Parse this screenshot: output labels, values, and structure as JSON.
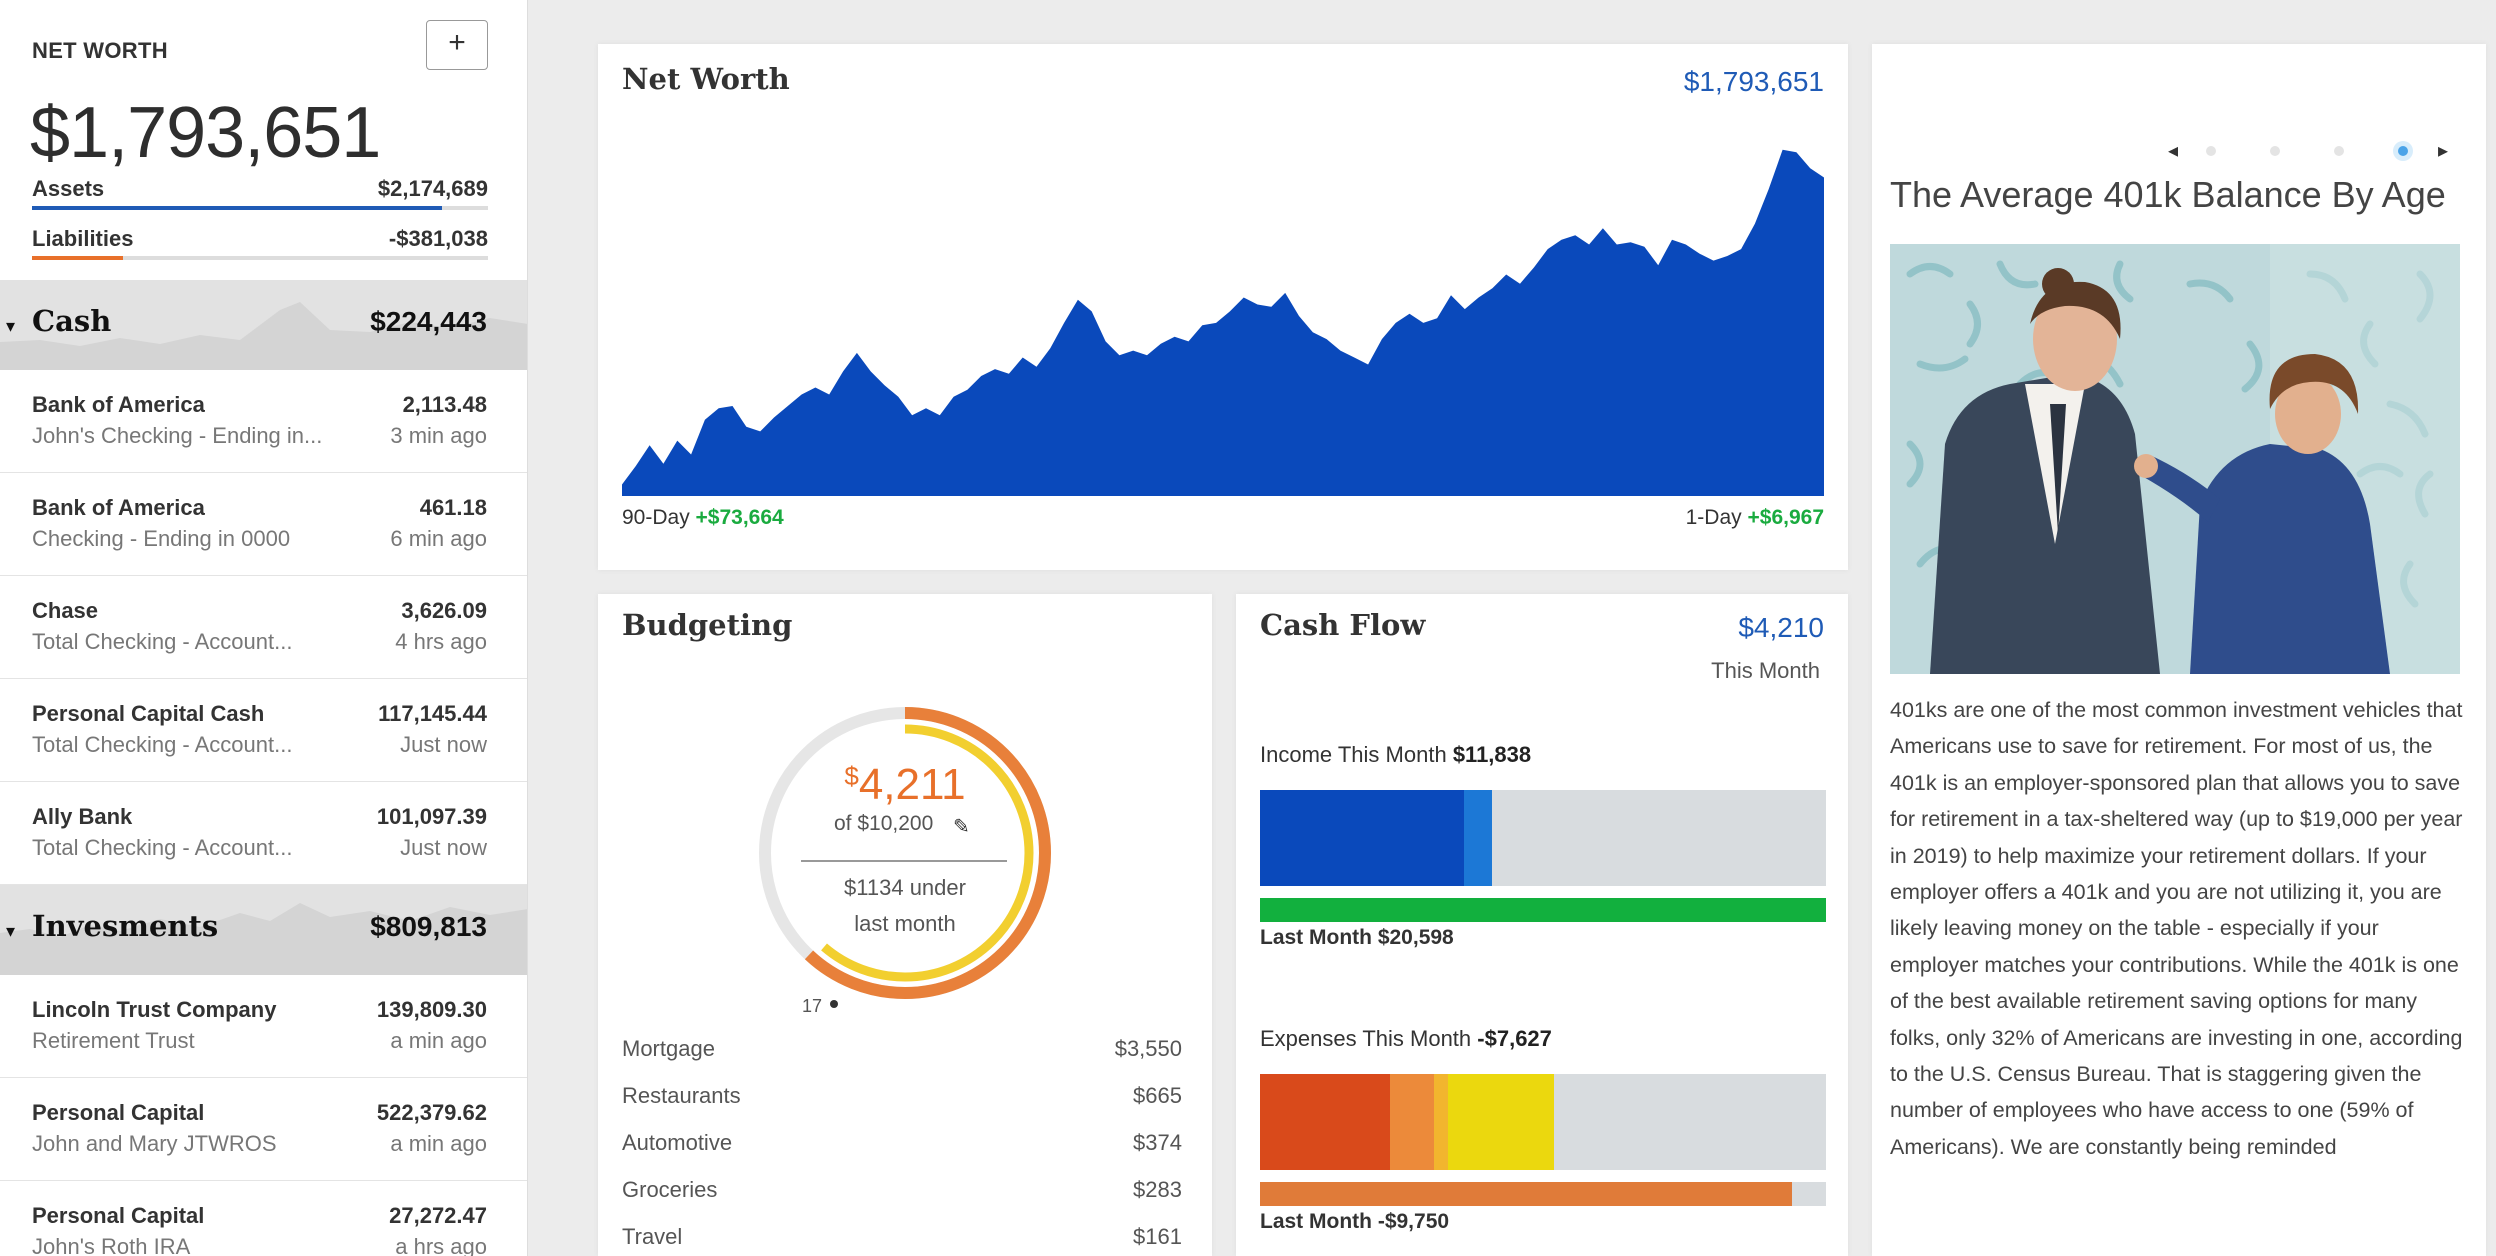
{
  "sidebar": {
    "net_worth_label": "NET WORTH",
    "add_label": "+",
    "net_worth_total": "$1,793,651",
    "assets": {
      "label": "Assets",
      "value": "$2,174,689",
      "bar_fraction": 0.9,
      "color": "#1f5bb6"
    },
    "liabilities": {
      "label": "Liabilities",
      "value": "-$381,038",
      "bar_fraction": 0.2,
      "color": "#e8702a"
    },
    "groups": [
      {
        "caret": "▾",
        "name": "Cash",
        "total": "$224,443",
        "accounts": [
          {
            "institution": "Bank of America",
            "description": "John's Checking - Ending in...",
            "balance": "2,113.48",
            "updated": "3 min ago"
          },
          {
            "institution": "Bank of America",
            "description": "Checking - Ending in 0000",
            "balance": "461.18",
            "updated": "6 min ago"
          },
          {
            "institution": "Chase",
            "description": "Total Checking - Account...",
            "balance": "3,626.09",
            "updated": "4 hrs ago"
          },
          {
            "institution": "Personal Capital Cash",
            "description": "Total Checking - Account...",
            "balance": "117,145.44",
            "updated": "Just now"
          },
          {
            "institution": "Ally Bank",
            "description": "Total Checking - Account...",
            "balance": "101,097.39",
            "updated": "Just now"
          }
        ]
      },
      {
        "caret": "▾",
        "name": "Invesments",
        "total": "$809,813",
        "accounts": [
          {
            "institution": "Lincoln Trust Company",
            "description": "Retirement Trust",
            "balance": "139,809.30",
            "updated": "a min ago"
          },
          {
            "institution": "Personal Capital",
            "description": "John and Mary JTWROS",
            "balance": "522,379.62",
            "updated": "a min ago"
          },
          {
            "institution": "Personal Capital",
            "description": "John's Roth IRA",
            "balance": "27,272.47",
            "updated": "a hrs ago"
          }
        ]
      }
    ]
  },
  "net_worth_card": {
    "title": "Net Worth",
    "amount": "$1,793,651",
    "left_label": "90-Day",
    "left_change": "+$73,664",
    "right_label": "1-Day",
    "right_change": "+$6,967",
    "color": "#0a49bb",
    "series": [
      0.05,
      0.13,
      0.22,
      0.14,
      0.24,
      0.18,
      0.33,
      0.38,
      0.39,
      0.3,
      0.28,
      0.34,
      0.39,
      0.44,
      0.47,
      0.44,
      0.54,
      0.62,
      0.54,
      0.48,
      0.43,
      0.35,
      0.38,
      0.35,
      0.43,
      0.46,
      0.52,
      0.55,
      0.53,
      0.6,
      0.56,
      0.64,
      0.75,
      0.85,
      0.8,
      0.67,
      0.61,
      0.63,
      0.61,
      0.66,
      0.69,
      0.67,
      0.74,
      0.75,
      0.8,
      0.86,
      0.83,
      0.82,
      0.88,
      0.78,
      0.71,
      0.68,
      0.63,
      0.6,
      0.57,
      0.68,
      0.75,
      0.79,
      0.75,
      0.77,
      0.87,
      0.81,
      0.86,
      0.9,
      0.96,
      0.92,
      0.99,
      1.07,
      1.11,
      1.13,
      1.09,
      1.16,
      1.09,
      1.1,
      1.08,
      1.0,
      1.11,
      1.09,
      1.05,
      1.02,
      1.04,
      1.07,
      1.18,
      1.33,
      1.5,
      1.49,
      1.42,
      1.38
    ]
  },
  "budgeting_card": {
    "title": "Budgeting",
    "currency": "$",
    "spent": "4,211",
    "of_text": "of $10,200",
    "under_line1": "$1134 under",
    "under_line2": "last month",
    "day": "17",
    "spent_fraction": 0.413,
    "colors": {
      "ring": "#e8803a",
      "inner": "#f2cf2f",
      "track": "#e6e6e6"
    },
    "categories": [
      {
        "name": "Mortgage",
        "amount": "$3,550"
      },
      {
        "name": "Restaurants",
        "amount": "$665"
      },
      {
        "name": "Automotive",
        "amount": "$374"
      },
      {
        "name": "Groceries",
        "amount": "$283"
      },
      {
        "name": "Travel",
        "amount": "$161"
      }
    ]
  },
  "cash_flow_card": {
    "title": "Cash Flow",
    "amount": "$4,210",
    "period": "This Month",
    "income_label": "Income This Month",
    "income_value": "$11,838",
    "income_fraction": 0.41,
    "income_last_label": "Last Month",
    "income_last_value": "$20,598",
    "expenses_label": "Expenses This Month",
    "expenses_value": "-$7,627",
    "expenses_fraction": 0.52,
    "expenses_last_label": "Last Month",
    "expenses_last_value": "-$9,750",
    "expenses_last_fraction": 0.94,
    "colors": {
      "income": "#0a49bb",
      "income_last": "#12b03e",
      "expenses_last": "#e07b39",
      "track": "#d8dcdf"
    }
  },
  "article_card": {
    "title": "The Average 401k Balance By Age",
    "body": "401ks are one of the most common investment vehicles that Americans use to save for retirement. For most of us, the 401k is an employer-sponsored plan that allows you to save for retirement in a tax-sheltered way (up to $19,000 per year in 2019) to help maximize your retirement dollars.  If your employer offers a 401k and you are not utilizing it, you are likely leaving money on the table - especially if your employer matches your contributions. While the 401k is one of the best available retirement saving options for many folks, only 32% of Americans are investing in one, according to the U.S. Census Bureau. That is staggering given the number of employees who have access to one (59% of Americans).  We are constantly being reminded",
    "carousel_prev": "◂",
    "carousel_next": "▸",
    "carousel_count": 5,
    "carousel_active": 4
  }
}
